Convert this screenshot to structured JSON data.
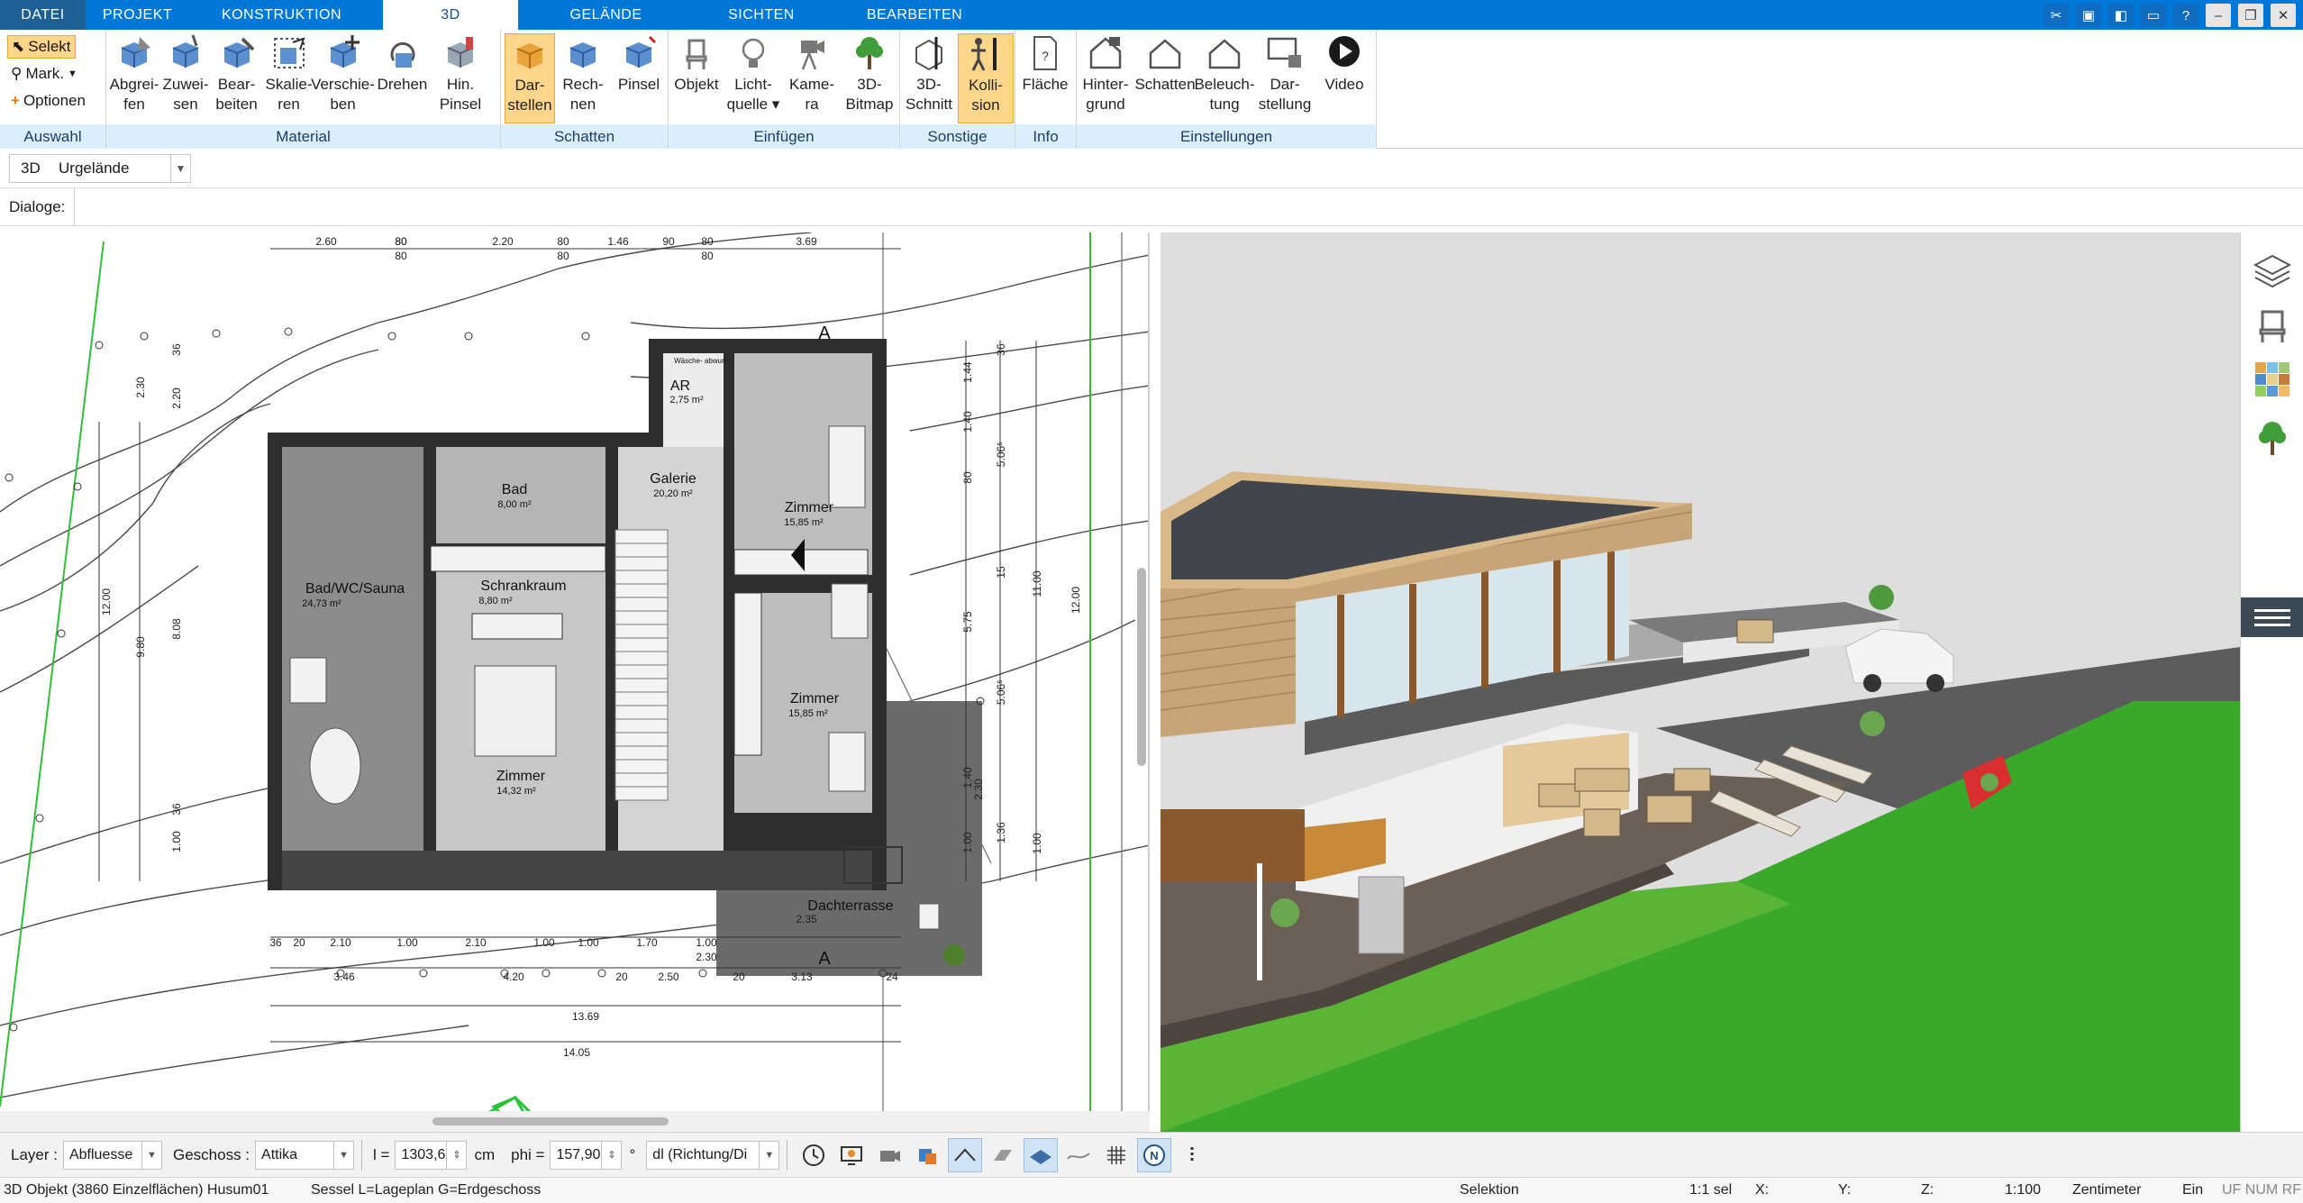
{
  "tabs": [
    "DATEI",
    "PROJEKT",
    "KONSTRUKTION",
    "3D",
    "GELÄNDE",
    "SICHTEN",
    "BEARBEITEN"
  ],
  "active_tab": "3D",
  "ribbon": {
    "auswahl": {
      "label": "Auswahl",
      "select": "Selekt",
      "mark": "Mark.",
      "options": "Optionen"
    },
    "material": {
      "label": "Material",
      "buttons": [
        "Abgrei-|fen",
        "Zuwei-|sen",
        "Bear-|beiten",
        "Skalie-|ren",
        "Verschie-|ben",
        "Drehen|",
        "Hin.|Pinsel"
      ]
    },
    "schatten": {
      "label": "Schatten",
      "buttons": [
        "Dar-|stellen",
        "Rech-|nen",
        "Pinsel|"
      ]
    },
    "einfuegen": {
      "label": "Einfügen",
      "buttons": [
        "Objekt|",
        "Licht-|quelle ▾",
        "Kame-|ra",
        "3D-|Bitmap"
      ]
    },
    "sonstige": {
      "label": "Sonstige",
      "buttons": [
        "3D-|Schnitt",
        "Kolli-|sion"
      ]
    },
    "info": {
      "label": "Info",
      "buttons": [
        "Fläche|"
      ]
    },
    "einstellungen": {
      "label": "Einstellungen",
      "buttons": [
        "Hinter-|grund",
        "Schatten|",
        "Beleuch-|tung",
        "Dar-|stellung",
        "Video|"
      ]
    }
  },
  "toolbar2": {
    "prefix": "3D",
    "value": "Urgelände"
  },
  "toolbar3": {
    "label": "Dialoge:"
  },
  "plan": {
    "rooms": [
      {
        "name": "Bad",
        "area": "8,00 m²"
      },
      {
        "name": "Galerie",
        "area": "20,20 m²"
      },
      {
        "name": "AR",
        "area": "2,75 m²"
      },
      {
        "name": "Zimmer",
        "area": "15,85 m²"
      },
      {
        "name": "Bad/WC/Sauna",
        "area": "24,73 m²"
      },
      {
        "name": "Schrankraum",
        "area": "8,80 m²"
      },
      {
        "name": "Zimmer",
        "area": "15,85 m²"
      },
      {
        "name": "Zimmer",
        "area": "14,32 m²"
      },
      {
        "name": "Dachterrasse",
        "area": ""
      }
    ],
    "note": "Wäsche-|abwurf",
    "section_mark": "A",
    "dims_top": [
      "2.60",
      "80",
      "80",
      "2.20",
      "80",
      "1.46",
      "90",
      "80",
      "3.69",
      "80",
      "80",
      "80"
    ],
    "dims_bottom1": [
      "36",
      "20",
      "2.10",
      "1.00",
      "2.10",
      "1.00",
      "1.00",
      "1.70",
      "1.00",
      "2.30"
    ],
    "dims_bottom2": [
      "3.46",
      "4.20",
      "20",
      "2.50",
      "20",
      "3.13",
      "24"
    ],
    "dims_bottom3": [
      "13.69",
      "14.05",
      "2.35"
    ],
    "dims_left": [
      "2.30",
      "2.20",
      "36",
      "12.00",
      "9.80",
      "8.08",
      "36",
      "1.00"
    ],
    "dims_right": [
      "1.44",
      "36",
      "1.40",
      "80",
      "5.06⁵",
      "15",
      "5.75",
      "11.00",
      "12.00",
      "5.06⁵",
      "1.40",
      "2.30",
      "1.00",
      "1.36",
      "1.00"
    ]
  },
  "bottombar": {
    "layer_label": "Layer :",
    "layer_value": "Abfluesse",
    "geschoss_label": "Geschoss :",
    "geschoss_value": "Attika",
    "l_label": "l =",
    "l_value": "1303,6",
    "l_unit": "cm",
    "phi_label": "phi =",
    "phi_value": "157,90",
    "phi_unit": "°",
    "dir_value": "dl (Richtung/Di"
  },
  "status": {
    "left": "3D Objekt (3860 Einzelflächen) Husum01",
    "hint": "Sessel L=Lageplan G=Erdgeschoss",
    "mode": "Selektion",
    "sel": "1:1 sel",
    "x": "X:",
    "y": "Y:",
    "z": "Z:",
    "scale": "1:100",
    "unit": "Zentimeter",
    "ein": "Ein",
    "flags": "UF NUM RF"
  },
  "colors": {
    "tab_blue": "#0078d7",
    "ribbon_group": "#dbeefc",
    "selected": "#fdd58b",
    "wall": "#3b3b3b",
    "lawn": "#3faa2c"
  }
}
